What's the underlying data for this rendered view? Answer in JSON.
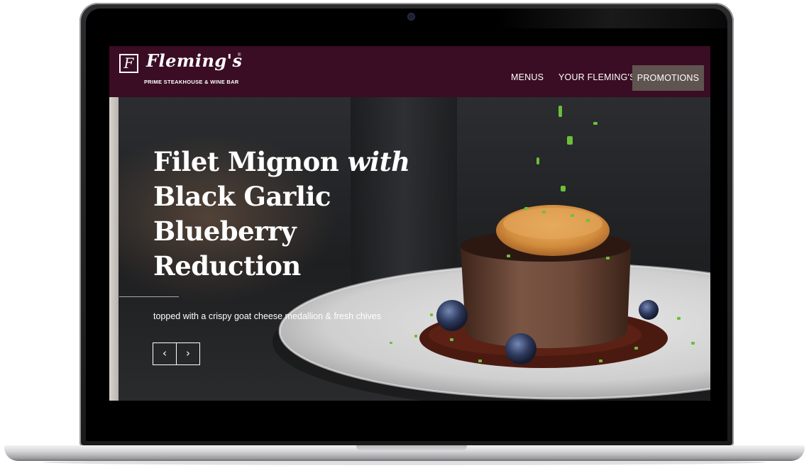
{
  "site": {
    "logo_mark": "F",
    "logo_name": "Fleming's",
    "logo_registered": "®",
    "logo_tagline": "PRIME STEAKHOUSE & WINE BAR"
  },
  "nav": {
    "items": [
      {
        "label": "MENUS"
      },
      {
        "label": "YOUR FLEMING'S"
      },
      {
        "label": "PROMOTIONS",
        "active": true
      }
    ]
  },
  "hero": {
    "title_line1_main": "Filet Mignon",
    "title_line1_italic": "with",
    "title_line2": "Black Garlic",
    "title_line3": "Blueberry",
    "title_line4": "Reduction",
    "subtitle": "topped with a crispy goat cheese medallion & fresh chives",
    "prev_arrow": "‹",
    "next_arrow": "›"
  },
  "colors": {
    "nav_background": "#3a0d24",
    "nav_active": "#5f5450",
    "text": "#ffffff"
  }
}
